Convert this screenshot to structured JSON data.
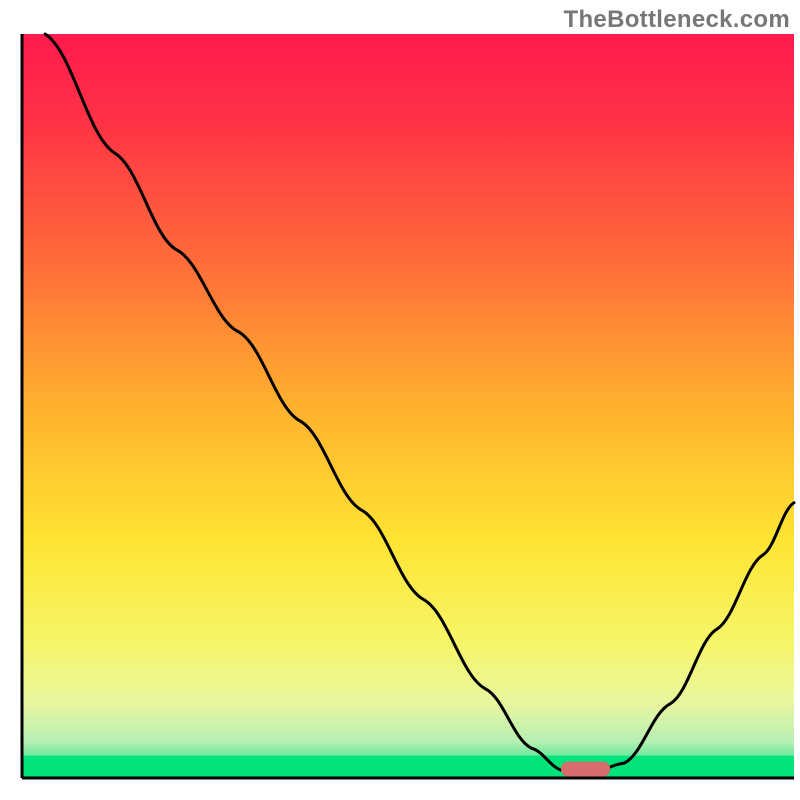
{
  "watermark": "TheBottleneck.com",
  "chart_data": {
    "type": "line",
    "title": "",
    "xlabel": "",
    "ylabel": "",
    "xlim": [
      0,
      100
    ],
    "ylim": [
      0,
      100
    ],
    "gradient_stops": [
      {
        "offset": 0.0,
        "color": "#ff1a4d"
      },
      {
        "offset": 0.12,
        "color": "#ff3345"
      },
      {
        "offset": 0.3,
        "color": "#ff6a3a"
      },
      {
        "offset": 0.5,
        "color": "#ffb12e"
      },
      {
        "offset": 0.68,
        "color": "#ffe432"
      },
      {
        "offset": 0.82,
        "color": "#f6f66a"
      },
      {
        "offset": 0.9,
        "color": "#e8f6a0"
      },
      {
        "offset": 0.95,
        "color": "#b8efb4"
      },
      {
        "offset": 1.0,
        "color": "#00e27a"
      }
    ],
    "green_band_y": [
      0,
      3
    ],
    "series": [
      {
        "name": "bottleneck-curve",
        "color": "#000000",
        "points": [
          {
            "x": 3,
            "y": 100
          },
          {
            "x": 12,
            "y": 84
          },
          {
            "x": 20,
            "y": 71
          },
          {
            "x": 28,
            "y": 60
          },
          {
            "x": 36,
            "y": 48
          },
          {
            "x": 44,
            "y": 36
          },
          {
            "x": 52,
            "y": 24
          },
          {
            "x": 60,
            "y": 12
          },
          {
            "x": 66,
            "y": 4
          },
          {
            "x": 70,
            "y": 1
          },
          {
            "x": 74,
            "y": 0.8
          },
          {
            "x": 78,
            "y": 2
          },
          {
            "x": 84,
            "y": 10
          },
          {
            "x": 90,
            "y": 20
          },
          {
            "x": 96,
            "y": 30
          },
          {
            "x": 100,
            "y": 37
          }
        ]
      }
    ],
    "marker": {
      "name": "optimal-point",
      "cx": 73,
      "cy": 1.2,
      "rx": 3.2,
      "ry": 1.0,
      "color": "#d86b6b"
    },
    "axes": {
      "visible": true,
      "color": "#000000",
      "width": 3
    }
  }
}
